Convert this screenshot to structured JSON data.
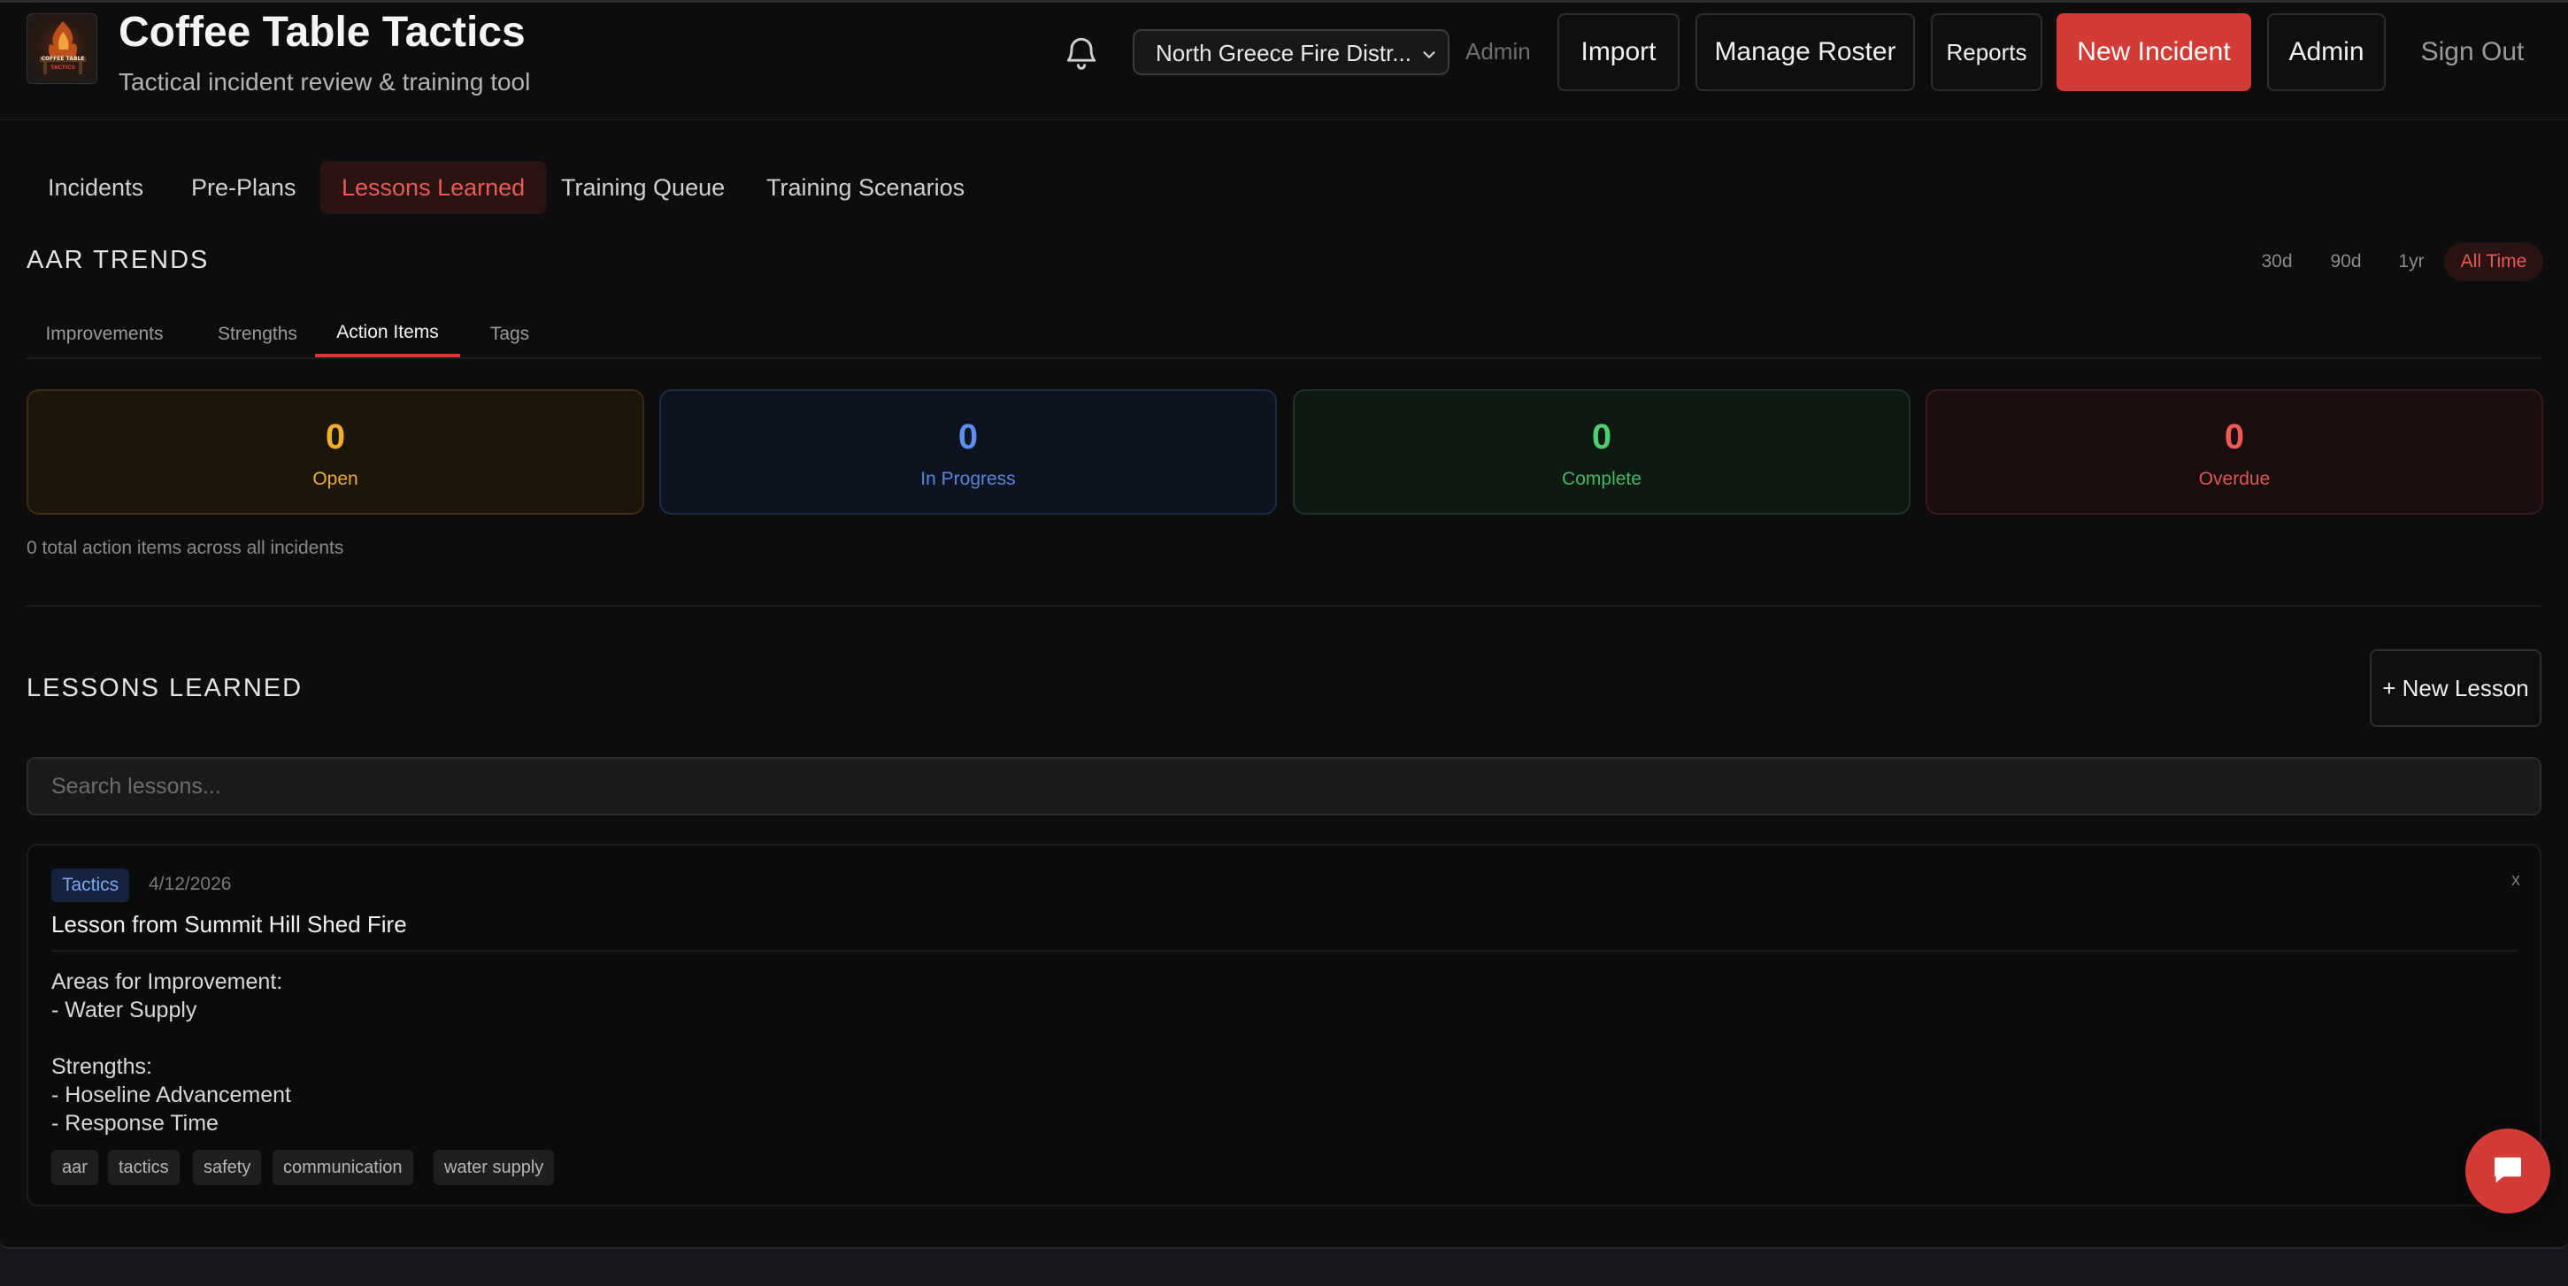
{
  "header": {
    "title": "Coffee Table Tactics",
    "subtitle": "Tactical incident review & training tool",
    "logo_text": "COFFEE TABLE TACTICS",
    "department": "North Greece Fire Distr...",
    "role": "Admin",
    "buttons": {
      "import": "Import",
      "manage_roster": "Manage Roster",
      "reports": "Reports",
      "new_incident": "New Incident",
      "admin": "Admin",
      "sign_out": "Sign Out"
    },
    "icons": {
      "notifications": "bell-icon",
      "dropdown": "chevron-down-icon"
    }
  },
  "tabs": [
    {
      "label": "Incidents",
      "active": false
    },
    {
      "label": "Pre-Plans",
      "active": false
    },
    {
      "label": "Lessons Learned",
      "active": true
    },
    {
      "label": "Training Queue",
      "active": false
    },
    {
      "label": "Training Scenarios",
      "active": false
    }
  ],
  "aar": {
    "title": "AAR TRENDS",
    "ranges": [
      {
        "label": "30d",
        "active": false
      },
      {
        "label": "90d",
        "active": false
      },
      {
        "label": "1yr",
        "active": false
      },
      {
        "label": "All Time",
        "active": true
      }
    ],
    "subtabs": [
      {
        "label": "Improvements",
        "active": false
      },
      {
        "label": "Strengths",
        "active": false
      },
      {
        "label": "Action Items",
        "active": true
      },
      {
        "label": "Tags",
        "active": false
      }
    ],
    "stats": {
      "open": {
        "value": "0",
        "label": "Open",
        "color": "#f0b02a"
      },
      "in_progress": {
        "value": "0",
        "label": "In Progress",
        "color": "#5b8ff0"
      },
      "complete": {
        "value": "0",
        "label": "Complete",
        "color": "#4fcf73"
      },
      "overdue": {
        "value": "0",
        "label": "Overdue",
        "color": "#ee5a56"
      }
    },
    "total_note": "0 total action items across all incidents"
  },
  "lessons": {
    "title": "LESSONS LEARNED",
    "new_button": "+ New Lesson",
    "search_placeholder": "Search lessons...",
    "items": [
      {
        "category": "Tactics",
        "date": "4/12/2026",
        "close": "x",
        "title": "Lesson from Summit Hill Shed Fire",
        "body": {
          "improvement_heading": "Areas for Improvement:",
          "improvements": [
            "- Water Supply"
          ],
          "strength_heading": "Strengths:",
          "strengths": [
            "- Hoseline Advancement",
            "- Response Time"
          ]
        },
        "tags": [
          "aar",
          "tactics",
          "safety",
          "communication",
          "water supply"
        ]
      }
    ]
  },
  "chat": {
    "icon": "chat-bubble-icon"
  },
  "colors": {
    "accent": "#d33b37",
    "background": "#0d0d0d"
  }
}
